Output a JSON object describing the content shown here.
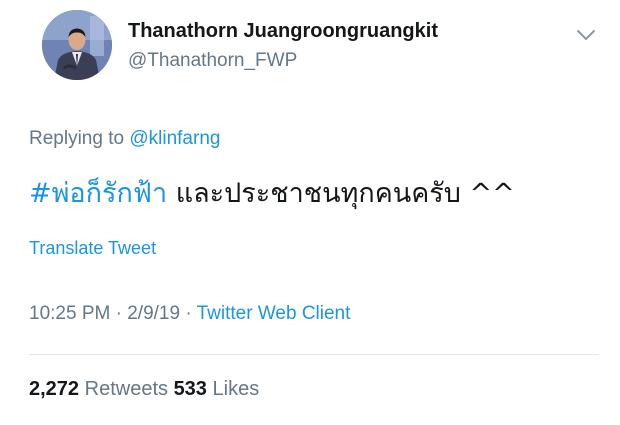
{
  "author": {
    "display_name": "Thanathorn Juangroongruangkit",
    "handle": "@Thanathorn_FWP"
  },
  "reply": {
    "prefix": "Replying to",
    "mention": "@klinfarng"
  },
  "tweet": {
    "hashtag": "#พ่อก็รักฟ้า",
    "text": "และประชาชนทุกคนครับ ^^"
  },
  "translate_label": "Translate Tweet",
  "meta": {
    "time": "10:25 PM",
    "separator1": "·",
    "date": "2/9/19",
    "separator2": "·",
    "client": "Twitter Web Client"
  },
  "stats": {
    "retweets_count": "2,272",
    "retweets_label": "Retweets",
    "likes_count": "533",
    "likes_label": "Likes"
  },
  "icons": {
    "menu": "chevron-down-icon",
    "avatar": "avatar"
  },
  "colors": {
    "link": "#1b95e0",
    "secondary": "#657786",
    "primary": "#14171a",
    "divider": "#e1e8ed"
  }
}
